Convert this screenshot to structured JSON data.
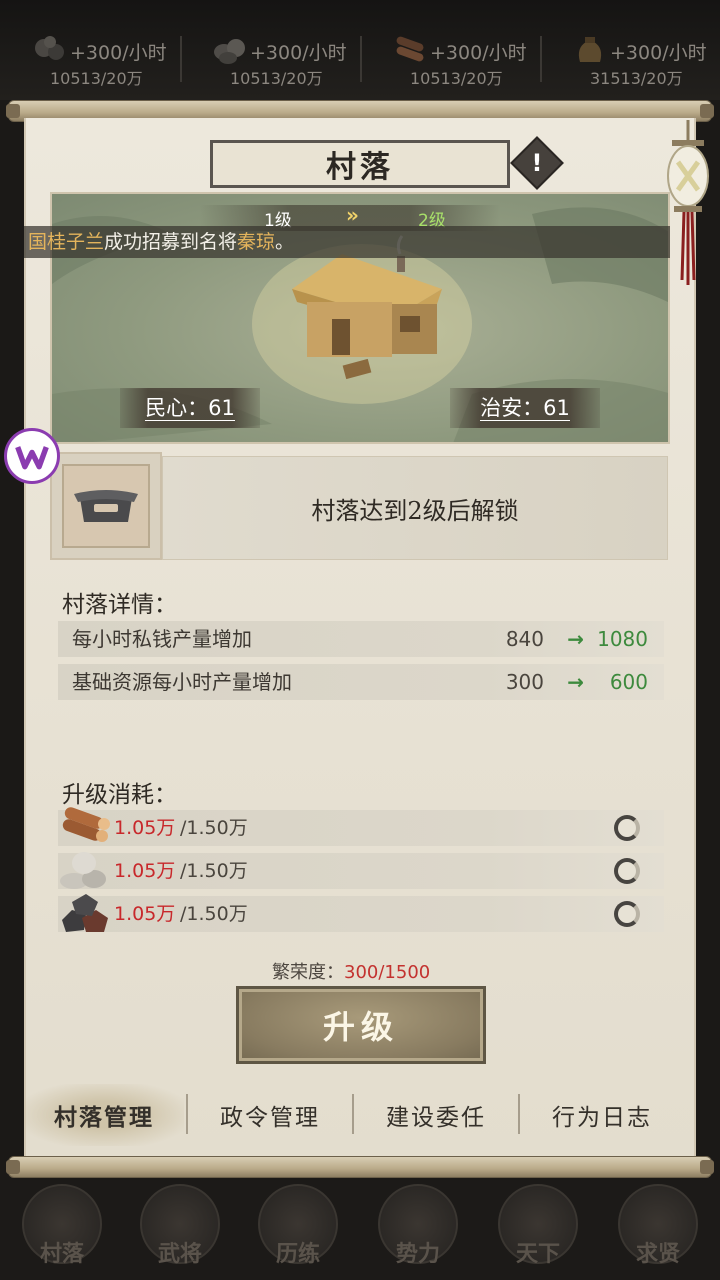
{
  "resources": [
    {
      "icon": "wood-resource-icon",
      "rate": "+300/小时",
      "total": "10513/20万"
    },
    {
      "icon": "stone-resource-icon",
      "rate": "+300/小时",
      "total": "10513/20万"
    },
    {
      "icon": "timber-resource-icon",
      "rate": "+300/小时",
      "total": "10513/20万"
    },
    {
      "icon": "grain-resource-icon",
      "rate": "+300/小时",
      "total": "31513/20万"
    }
  ],
  "panel": {
    "title": "村落",
    "info_icon": "!",
    "level_from": "1级",
    "level_arrow": "»",
    "level_to": "2级"
  },
  "ticker": {
    "name_a": "国桂子兰",
    "text_a": "成功招募到名将",
    "name_b": "秦琼",
    "text_b": "。"
  },
  "stats": {
    "morale": "民心：61",
    "security": "治安：61"
  },
  "unlock_text": "村落达到2级后解锁",
  "details": {
    "title": "村落详情：",
    "rows": [
      {
        "label": "每小时私钱产量增加",
        "from": "840",
        "arrow": "→",
        "to": "1080"
      },
      {
        "label": "基础资源每小时产量增加",
        "from": "300",
        "arrow": "→",
        "to": "600"
      }
    ]
  },
  "costs": {
    "title": "升级消耗：",
    "items": [
      {
        "icon": "wood-log-icon",
        "have": "1.05万",
        "need": "/1.50万"
      },
      {
        "icon": "stone-pile-icon",
        "have": "1.05万",
        "need": "/1.50万"
      },
      {
        "icon": "iron-ore-icon",
        "have": "1.05万",
        "need": "/1.50万"
      }
    ]
  },
  "prosperity": {
    "label": "繁荣度：",
    "value": "300/1500"
  },
  "upgrade_label": "升级",
  "tabs": [
    "村落管理",
    "政令管理",
    "建设委任",
    "行为日志"
  ],
  "bottom_nav": [
    "村落",
    "武将",
    "历练",
    "势力",
    "天下",
    "求贤"
  ],
  "colors": {
    "accent_red": "#c8282b",
    "accent_green": "#3d8a3d",
    "gold": "#e4b45c"
  }
}
